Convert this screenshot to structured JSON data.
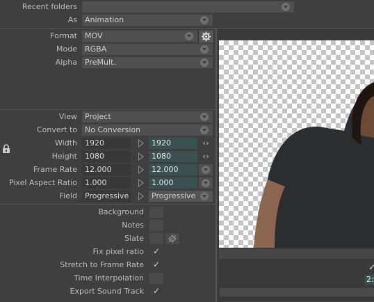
{
  "top": {
    "recent_folders_label": "Recent folders",
    "recent_folders_value": "",
    "as_label": "As",
    "as_value": "Animation"
  },
  "format_section": {
    "format_label": "Format",
    "format_value": "MOV",
    "mode_label": "Mode",
    "mode_value": "RGBA",
    "alpha_label": "Alpha",
    "alpha_value": "PreMult."
  },
  "view_section": {
    "view_label": "View",
    "view_value": "Project",
    "convert_label": "Convert to",
    "convert_value": "No Conversion",
    "width_label": "Width",
    "width_src": "1920",
    "width_dst": "1920",
    "height_label": "Height",
    "height_src": "1080",
    "height_dst": "1080",
    "framerate_label": "Frame Rate",
    "framerate_src": "12.000",
    "framerate_dst": "12.000",
    "par_label": "Pixel Aspect Ratio",
    "par_src": "1.000",
    "par_dst": "1.000",
    "field_label": "Field",
    "field_src": "Progressive",
    "field_dst": "Progressive"
  },
  "options": {
    "background_label": "Background",
    "notes_label": "Notes",
    "slate_label": "Slate",
    "fix_pixel_ratio_label": "Fix pixel ratio",
    "fix_pixel_ratio_checked": true,
    "stretch_label": "Stretch to Frame Rate",
    "stretch_checked": true,
    "time_interp_label": "Time Interpolation",
    "export_sound_label": "Export Sound Track",
    "export_sound_checked": true
  },
  "right_panel": {
    "timecode_partial": "2:"
  },
  "colors": {
    "panel_bg": "#3f3f3f",
    "dropdown_bg": "#4f4f4f",
    "field_bg": "#383838",
    "teal_field_bg": "#3a5150"
  },
  "icons": [
    "chevron-down-icon",
    "gear-icon",
    "lock-icon",
    "arrow-right-icon",
    "left-right-arrows-icon",
    "check-icon",
    "slate-settings-icon"
  ]
}
